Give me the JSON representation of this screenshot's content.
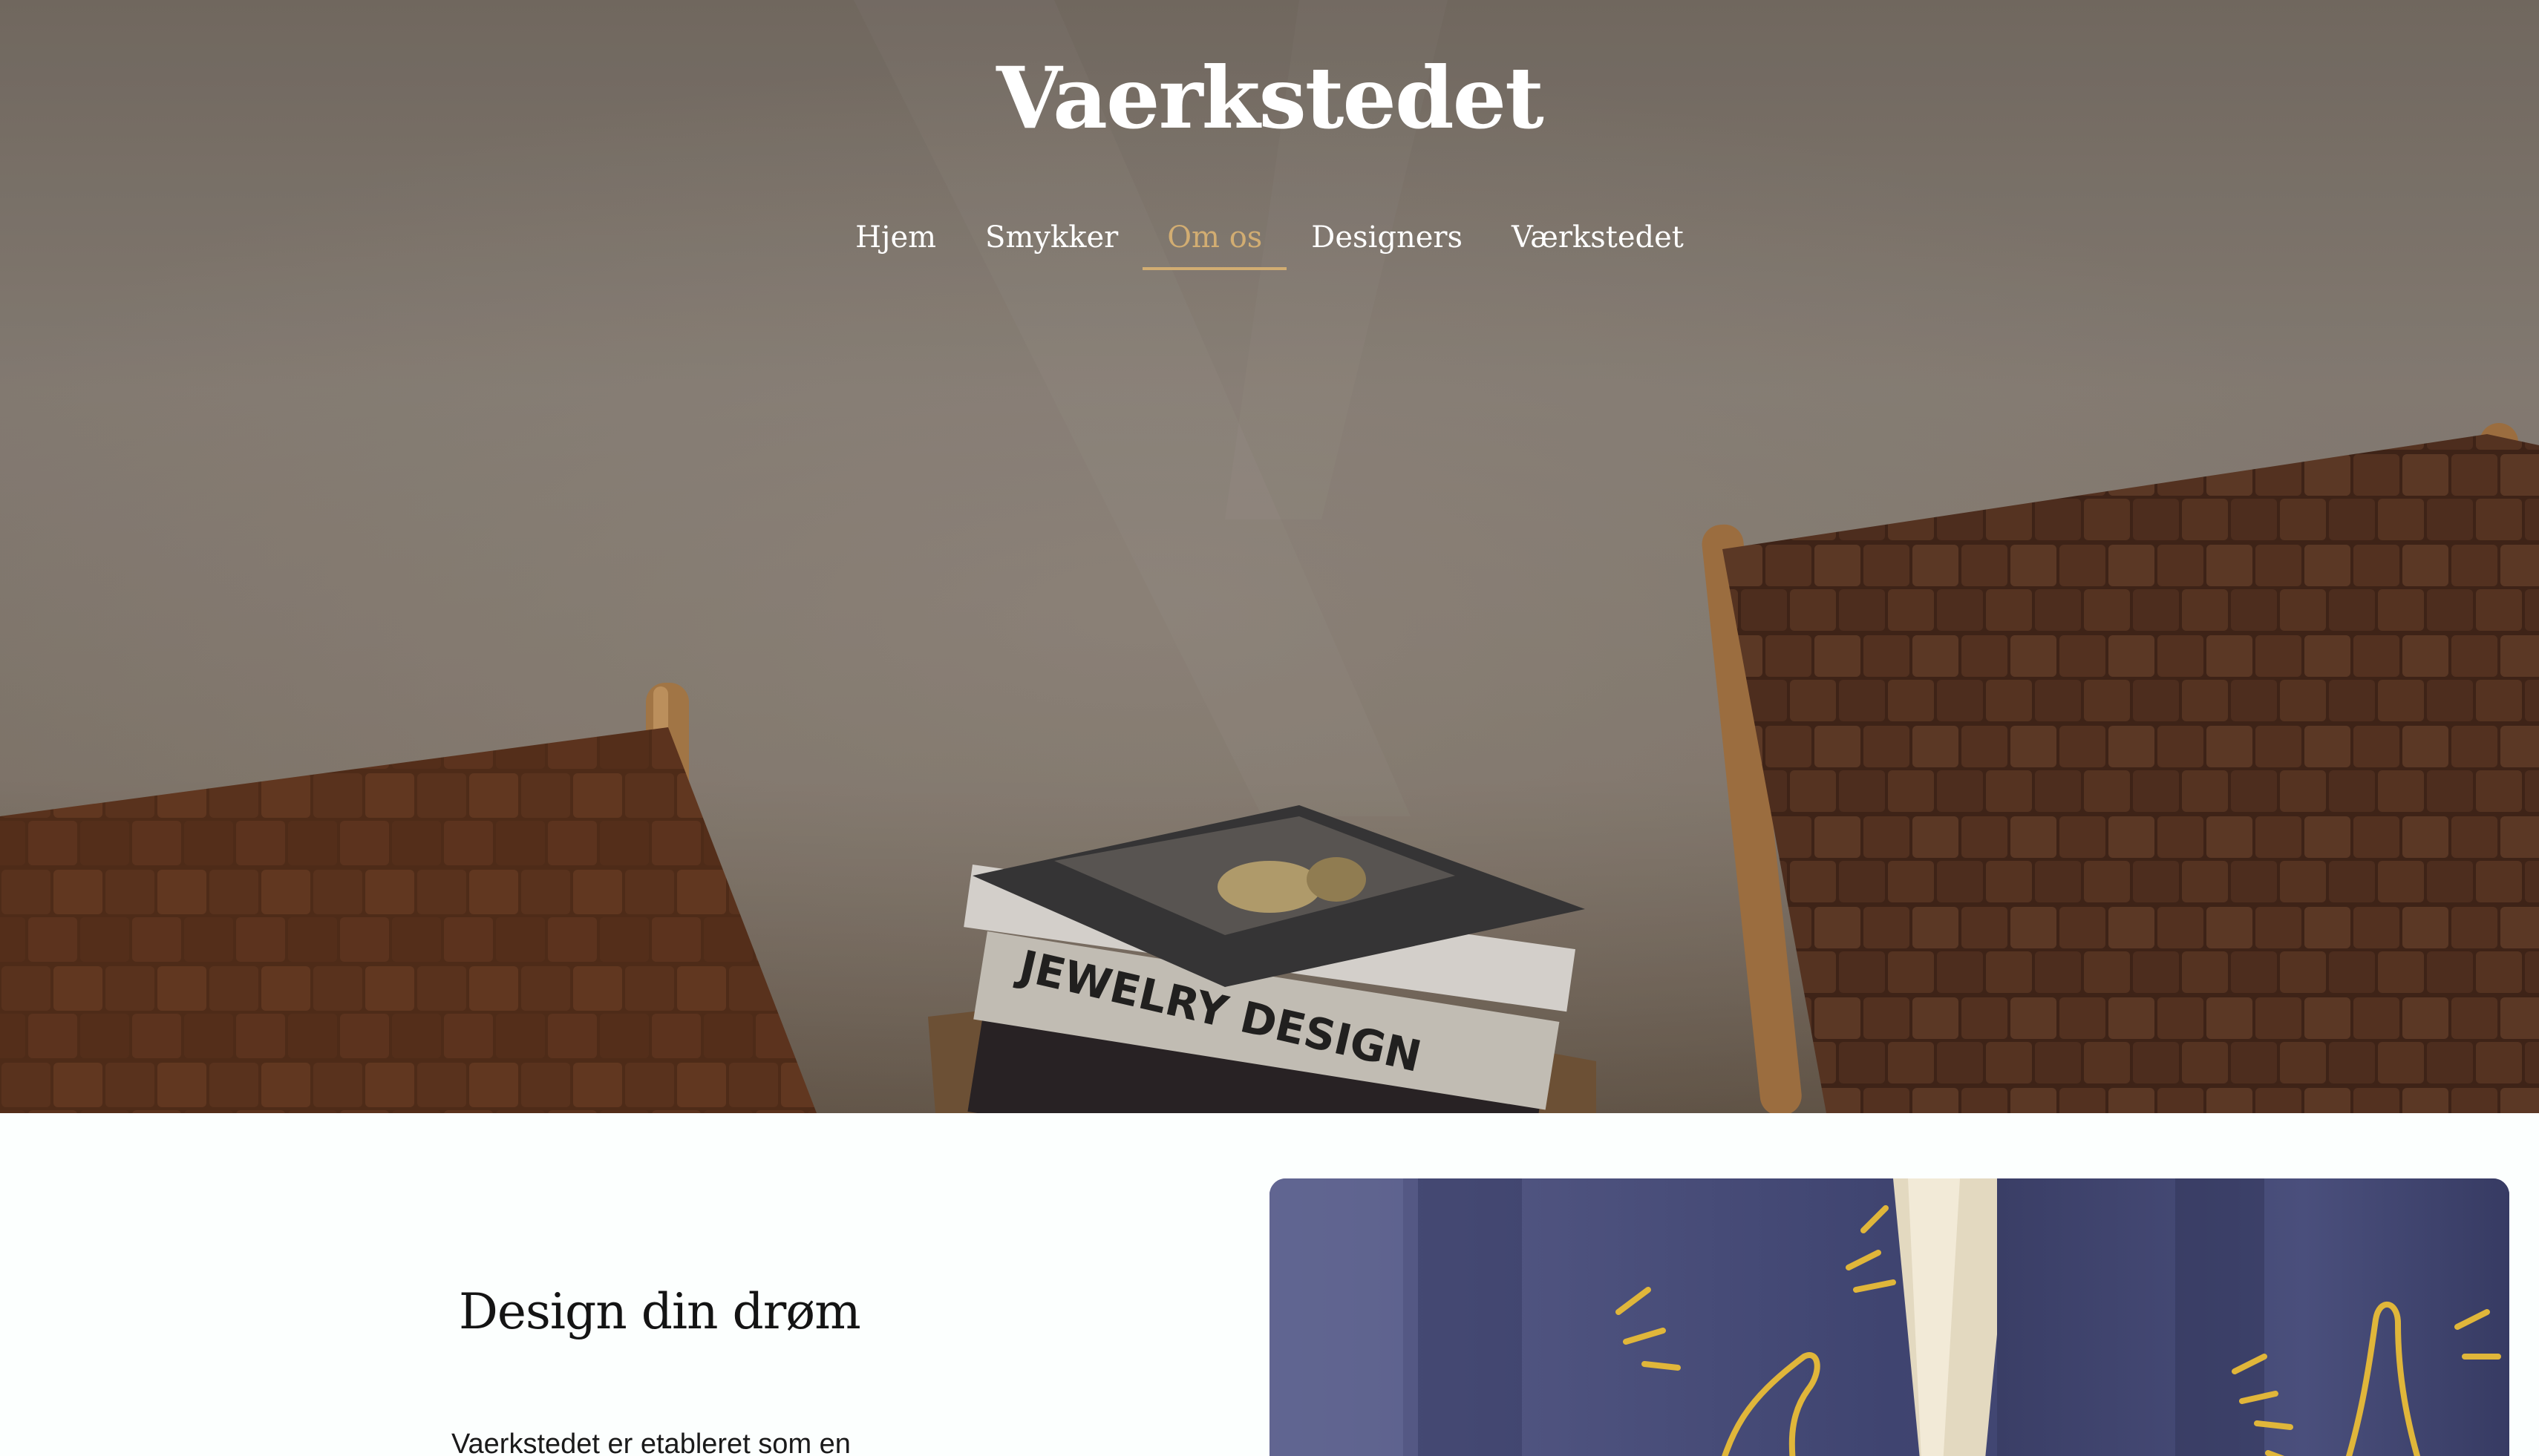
{
  "site": {
    "title": "Vaerkstedet"
  },
  "nav": {
    "items": [
      {
        "label": "Hjem",
        "name": "nav-hjem"
      },
      {
        "label": "Smykker",
        "name": "nav-smykker"
      },
      {
        "label": "Om os",
        "name": "nav-om-os",
        "active": true
      },
      {
        "label": "Designers",
        "name": "nav-designers"
      },
      {
        "label": "Værkstedet",
        "name": "nav-vaerkstedet"
      }
    ]
  },
  "hero": {
    "book_spine_text": "JEWELRY DESIGN",
    "book_spine_small": "Jewelry",
    "image_subject": "woven leather chairs with stacked books"
  },
  "section": {
    "heading": "Design din drøm",
    "body": "Vaerkstedet er etableret som en"
  },
  "feature_image": {
    "subject": "blue fabric bags with gold hand print"
  },
  "colors": {
    "accent": "#d2ad72",
    "title": "#ffffff",
    "background": "#fcfffe",
    "text": "#141414"
  }
}
